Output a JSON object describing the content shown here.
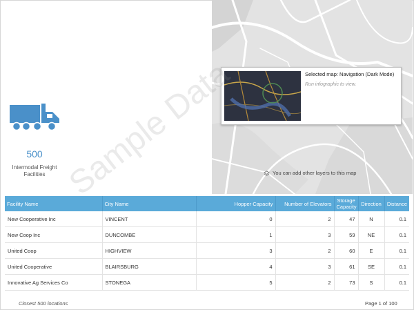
{
  "kpi": {
    "value": "500",
    "label": "Intermodal Freight Facilities",
    "icon": "truck-icon",
    "color": "#4a90c9"
  },
  "map": {
    "popup_title": "Selected map: Navigation (Dark Mode)",
    "popup_subtitle": "Run infographic to view.",
    "layers_hint": "You can add other layers to this map"
  },
  "watermark": "Sample Data",
  "table": {
    "columns": [
      "Facility Name",
      "City Name",
      "Hopper Capacity",
      "Number of Elevators",
      "Storage Capacity",
      "Direction",
      "Distance"
    ],
    "rows": [
      [
        "New Cooperative Inc",
        "VINCENT",
        "0",
        "2",
        "47",
        "N",
        "0.1"
      ],
      [
        "New Coop Inc",
        "DUNCOMBE",
        "1",
        "3",
        "59",
        "NE",
        "0.1"
      ],
      [
        "United Coop",
        "HIGHVIEW",
        "3",
        "2",
        "60",
        "E",
        "0.1"
      ],
      [
        "United Cooperative",
        "BLAIRSBURG",
        "4",
        "3",
        "61",
        "SE",
        "0.1"
      ],
      [
        "Innovative Ag Services Co",
        "STONEGA",
        "5",
        "2",
        "73",
        "S",
        "0.1"
      ]
    ]
  },
  "footer": {
    "left": "Closest 500 locations",
    "right": "Page 1 of 100"
  }
}
